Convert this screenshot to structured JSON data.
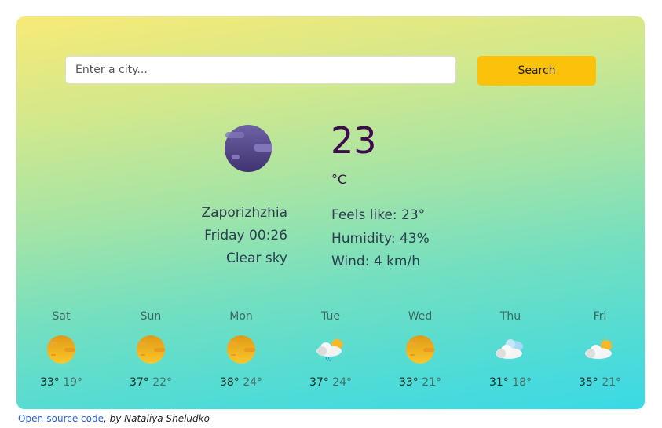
{
  "search": {
    "placeholder": "Enter a city...",
    "value": "",
    "button_label": "Search"
  },
  "current": {
    "icon": "moon-clear-night-icon",
    "temperature": "23",
    "unit": "°C",
    "city": "Zaporizhzhia",
    "datetime": "Friday 00:26",
    "description": "Clear sky",
    "feels_like": "Feels like: 23°",
    "humidity": "Humidity: 43%",
    "wind": "Wind: 4 km/h"
  },
  "forecast": [
    {
      "day": "Sat",
      "icon": "sun-icon",
      "max": "33°",
      "min": "19°"
    },
    {
      "day": "Sun",
      "icon": "sun-icon",
      "max": "37°",
      "min": "22°"
    },
    {
      "day": "Mon",
      "icon": "sun-icon",
      "max": "38°",
      "min": "24°"
    },
    {
      "day": "Tue",
      "icon": "rain-sun-cloud-icon",
      "max": "37°",
      "min": "24°"
    },
    {
      "day": "Wed",
      "icon": "sun-icon",
      "max": "33°",
      "min": "21°"
    },
    {
      "day": "Thu",
      "icon": "clouds-icon",
      "max": "31°",
      "min": "18°"
    },
    {
      "day": "Fri",
      "icon": "partly-cloudy-icon",
      "max": "35°",
      "min": "21°"
    }
  ],
  "footer": {
    "link_text": "Open-source code",
    "author_text": ", by Nataliya Sheludko"
  },
  "colors": {
    "button": "#fcc10a",
    "temperature": "#3d0b4e",
    "link": "#2a62d8"
  }
}
